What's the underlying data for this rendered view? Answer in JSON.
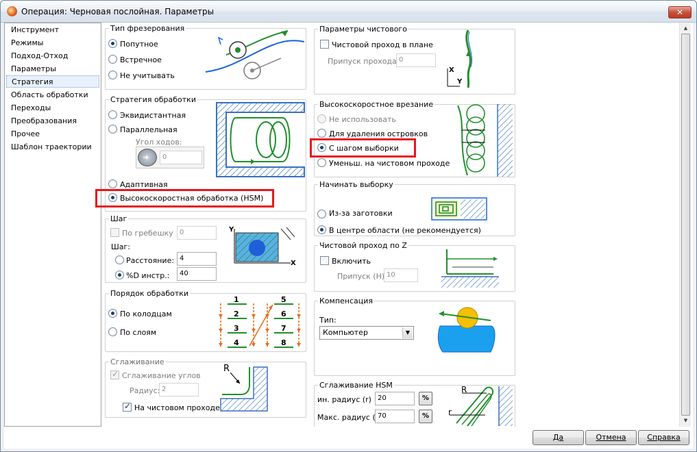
{
  "window": {
    "title": "Операция: Черновая послойная. Параметры",
    "close_glyph": "✕"
  },
  "nav": {
    "items": [
      "Инструмент",
      "Режимы",
      "Подход-Отход",
      "Параметры",
      "Стратегия",
      "Область обработки",
      "Переходы",
      "Преобразования",
      "Прочее",
      "Шаблон траектории"
    ],
    "selected": "Стратегия"
  },
  "milling_type": {
    "title": "Тип фрезерования",
    "options": [
      "Попутное",
      "Встречное",
      "Не учитывать"
    ],
    "selected": "Попутное"
  },
  "strategy": {
    "title": "Стратегия обработки",
    "options": [
      "Эквидистантная",
      "Параллельная",
      "Адаптивная",
      "Высокоскоростная обработка (HSM)"
    ],
    "selected": "Высокоскоростная обработка (HSM)",
    "angle_label": "Угол ходов:",
    "angle_value": "0"
  },
  "step": {
    "title": "Шаг",
    "scallop_label": "По гребешку",
    "scallop_value": "0",
    "step_label": "Шаг:",
    "distance_label": "Расстояние:",
    "distance_value": "4",
    "percent_label": "%D инстр.:",
    "percent_value": "40",
    "selected": "%D инстр.:",
    "axis_y": "Y",
    "axis_x": "X"
  },
  "order": {
    "title": "Порядок обработки",
    "options": [
      "По колодцам",
      "По слоям"
    ],
    "selected": "По колодцам",
    "left_numbers": [
      "1",
      "2",
      "3",
      "4"
    ],
    "right_numbers": [
      "5",
      "6",
      "7",
      "8"
    ]
  },
  "smoothing": {
    "title": "Сглаживание",
    "corner_label": "Сглаживание углов",
    "radius_label": "Радиус:",
    "radius_value": "2",
    "finish_label": "На чистовом проходе",
    "r_label": "R"
  },
  "finish_params": {
    "title": "Параметры чистового",
    "plane_pass_label": "Чистовой проход в плане",
    "allowance_label": "Припуск прохода:",
    "allowance_value": "0",
    "axis_x": "X",
    "axis_y": "Y"
  },
  "hs_entry": {
    "title": "Высокоскоростное врезание",
    "options": [
      "Не использовать",
      "Для удаления островков",
      "С шагом выборки",
      "Уменьш. на чистовом проходе"
    ],
    "selected": "С шагом выборки"
  },
  "start_pocket": {
    "title": "Начинать выборку",
    "options": [
      "Из-за заготовки",
      "В центре области (не рекомендуется)"
    ],
    "selected": "В центре области (не рекомендуется)"
  },
  "finish_z": {
    "title": "Чистовой проход по Z",
    "enable_label": "Включить",
    "allowance_label": "Припуск (H):",
    "allowance_value": "10"
  },
  "compensation": {
    "title": "Компенсация",
    "type_label": "Тип:",
    "type_value": "Компьютер"
  },
  "hsm_smoothing": {
    "title": "Сглаживание HSM",
    "min_label": "ин. радиус (r)",
    "min_value": "20",
    "max_label": "Макс. радиус (R)",
    "max_value": "70",
    "pct": "%",
    "r_big": "R",
    "r_small": "r"
  },
  "buttons": {
    "ok": "Да",
    "cancel": "Отмена",
    "help": "Справка"
  },
  "colors": {
    "highlight": "#e8161b",
    "diagram_green": "#1f8f2a",
    "diagram_blue": "#1565d8",
    "hatch": "#3a6fbf"
  }
}
